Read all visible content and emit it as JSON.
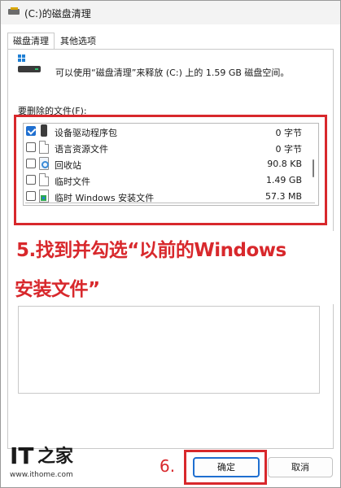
{
  "window": {
    "title": "(C:)的磁盘清理"
  },
  "tabs": [
    {
      "label": "磁盘清理",
      "active": true
    },
    {
      "label": "其他选项",
      "active": false
    }
  ],
  "header": {
    "space_message": "可以使用“磁盘清理”来释放  (C:) 上的 1.59 GB 磁盘空间。"
  },
  "files_section": {
    "label": "要删除的文件(F):",
    "items": [
      {
        "name": "设备驱动程序包",
        "size": "0 字节",
        "checked": true,
        "icon": "device-driver-icon"
      },
      {
        "name": "语言资源文件",
        "size": "0 字节",
        "checked": false,
        "icon": "document-icon"
      },
      {
        "name": "回收站",
        "size": "90.8 KB",
        "checked": false,
        "icon": "recycle-bin-icon"
      },
      {
        "name": "临时文件",
        "size": "1.49 GB",
        "checked": false,
        "icon": "document-icon"
      },
      {
        "name": "临时 Windows 安装文件",
        "size": "57.3 MB",
        "checked": false,
        "icon": "windows-install-icon"
      }
    ]
  },
  "annotation": {
    "caption_line1": "5.找到并勾选“以前的Windows",
    "caption_line2": "安装文件”",
    "step6_label": "6.",
    "accent_color": "#d8282c"
  },
  "brand": {
    "logo_latin": "IT",
    "logo_cjk": "之家",
    "url": "www.ithome.com"
  },
  "buttons": {
    "ok_label": "确定",
    "cancel_label": "取消"
  }
}
